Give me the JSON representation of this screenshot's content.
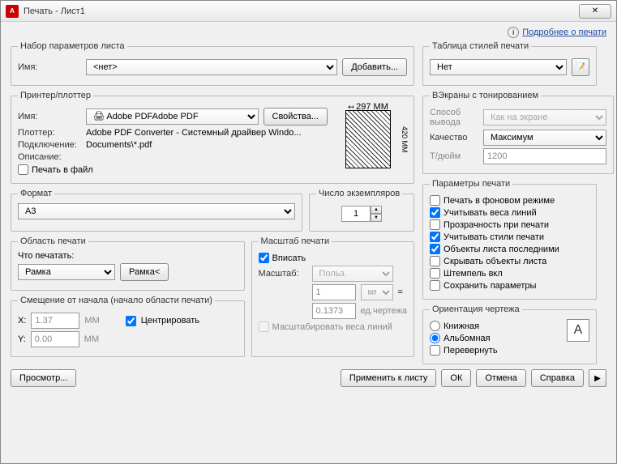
{
  "window": {
    "title": "Печать - Лист1"
  },
  "help": {
    "link": "Подробнее о печати"
  },
  "pageSetup": {
    "legend": "Набор параметров листа",
    "nameLabel": "Имя:",
    "nameValue": "<нет>",
    "addBtn": "Добавить..."
  },
  "printer": {
    "legend": "Принтер/плоттер",
    "nameLabel": "Имя:",
    "nameValue": "Adobe PDF",
    "propsBtn": "Свойства...",
    "plotterLabel": "Плоттер:",
    "plotterValue": "Adobe PDF Converter - Системный драйвер Windo...",
    "connectLabel": "Подключение:",
    "connectValue": "Documents\\*.pdf",
    "descLabel": "Описание:",
    "toFile": "Печать в файл",
    "paper": {
      "width": "297 MM",
      "height": "420 MM"
    }
  },
  "format": {
    "legend": "Формат",
    "value": "A3"
  },
  "copies": {
    "legend": "Число экземпляров",
    "value": "1"
  },
  "plotArea": {
    "legend": "Область печати",
    "whatLabel": "Что печатать:",
    "value": "Рамка",
    "windowBtn": "Рамка<"
  },
  "plotScale": {
    "legend": "Масштаб печати",
    "fitCheck": "Вписать",
    "scaleLabel": "Масштаб:",
    "scaleValue": "Польз.",
    "num": "1",
    "unit": "мм",
    "eq": "=",
    "den": "0.1373",
    "denUnit": "ед.чертежа",
    "weightsCheck": "Масштабировать веса линий"
  },
  "offset": {
    "legend": "Смещение от начала (начало области печати)",
    "x": "X:",
    "xVal": "1.37",
    "xu": "ММ",
    "y": "Y:",
    "yVal": "0.00",
    "yu": "ММ",
    "center": "Центрировать"
  },
  "styleTable": {
    "legend": "Таблица стилей печати",
    "value": "Нет"
  },
  "shadedViewport": {
    "legend": "ВЭкраны с тонированием",
    "shadeLabel": "Способ вывода",
    "shadeValue": "Как на экране",
    "qualityLabel": "Качество",
    "qualityValue": "Максимум",
    "dpiLabel": "Т/дюйм",
    "dpiValue": "1200"
  },
  "plotOptions": {
    "legend": "Параметры печати",
    "bg": "Печать в фоновом режиме",
    "weights": "Учитывать веса линий",
    "transparent": "Прозрачность при печати",
    "styles": "Учитывать стили печати",
    "last": "Объекты листа последними",
    "hide": "Скрывать объекты листа",
    "stamp": "Штемпель вкл",
    "save": "Сохранить параметры"
  },
  "orientation": {
    "legend": "Ориентация чертежа",
    "portrait": "Книжная",
    "landscape": "Альбомная",
    "upside": "Перевернуть"
  },
  "buttons": {
    "preview": "Просмотр...",
    "apply": "Применить к листу",
    "ok": "ОК",
    "cancel": "Отмена",
    "help": "Справка"
  }
}
